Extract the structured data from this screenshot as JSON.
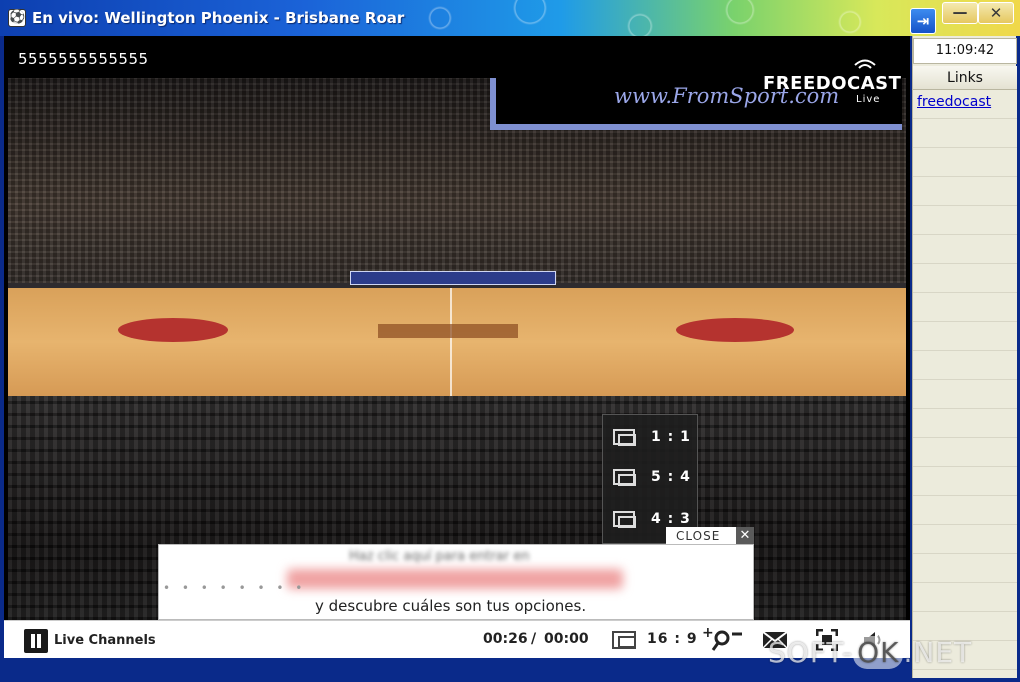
{
  "window": {
    "title": "En vivo: Wellington Phoenix - Brisbane Roar",
    "controls": {
      "minimize": "—",
      "close": "✕",
      "restore": "⇥"
    }
  },
  "video": {
    "overlay_code": "5555555555555",
    "brand": {
      "url": "www.FromSport.com",
      "name": "FREEDOCAST",
      "live": "Live"
    }
  },
  "aspect_menu": {
    "items": [
      "1 : 1",
      "5 : 4",
      "4 : 3"
    ]
  },
  "promo": {
    "close_label": "CLOSE",
    "line1": "Haz clic aquí para entrar en",
    "line2": "y descubre cuáles son tus opciones."
  },
  "controls": {
    "live_channels_label": "Live Channels",
    "time_current": "00:26",
    "time_separator": "/",
    "time_total": "00:00",
    "aspect_ratio": "16 : 9"
  },
  "sidepanel": {
    "clock": "11:09:42",
    "header": "Links",
    "links": [
      "freedocast"
    ]
  },
  "watermark": {
    "left": "SOFT-",
    "ok": "OK",
    "right": ".NET"
  },
  "icons": [
    "app-icon",
    "restore-icon",
    "minimize-icon",
    "close-icon",
    "signal-icon",
    "aspect-ratio-icon",
    "pause-icon",
    "zoom-icon",
    "mail-icon",
    "fullscreen-icon",
    "volume-icon"
  ]
}
